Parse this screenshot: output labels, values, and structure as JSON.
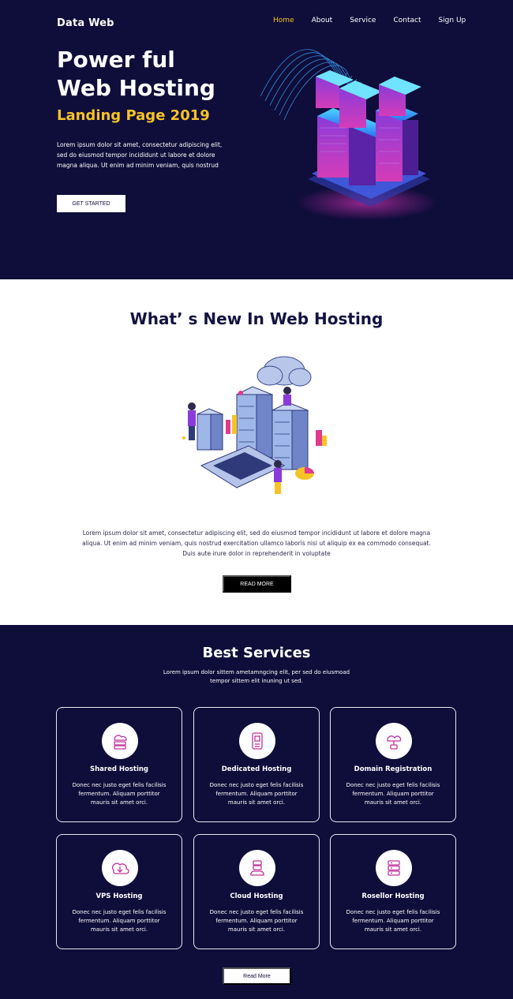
{
  "header": {
    "brand": "Data Web",
    "nav": [
      "Home",
      "About",
      "Service",
      "Contact",
      "Sign Up"
    ],
    "active_nav": "Home"
  },
  "hero": {
    "title_line1": "Power ful",
    "title_line2": "Web Hosting",
    "subtitle": "Landing Page 2019",
    "text": "Lorem ipsum dolor sit amet, consectetur adipiscing elit, sed do eiusmod tempor incididunt ut labore et dolore magna aliqua. Ut enim ad minim veniam, quis nostrud",
    "button": "GET STARTED"
  },
  "whats_new": {
    "title": "What’ s New In Web Hosting",
    "text": "Lorem ipsum dolor sit amet, consectetur adipiscing elit, sed do eiusmod tempor incididunt ut labore et dolore magna aliqua. Ut enim ad minim veniam, quis nostrud exercitation ullamco laboris nisi ut aliquip ex ea commodo consequat. Duis aute irure dolor in reprehenderit in voluptate",
    "button": "READ MORE"
  },
  "services": {
    "title": "Best Services",
    "description": "Lorem ipsum dolor sittem ametamngcing elit, per sed do eiusmoad tempor sittem elit inuning ut sed.",
    "cards": [
      {
        "title": "Shared Hosting",
        "text": "Donec nec justo eget felis facilisis fermentum. Aliquam porttitor mauris sit amet orci.",
        "icon": "server-cloud-icon"
      },
      {
        "title": "Dedicated Hosting",
        "text": "Donec nec justo eget felis facilisis fermentum. Aliquam porttitor mauris sit amet orci.",
        "icon": "dedicated-server-icon"
      },
      {
        "title": "Domain Registration",
        "text": "Donec nec justo eget felis facilisis fermentum. Aliquam porttitor mauris sit amet orci.",
        "icon": "domain-cloud-icon"
      },
      {
        "title": "VPS Hosting",
        "text": "Donec nec justo eget felis facilisis fermentum. Aliquam porttitor mauris sit amet orci.",
        "icon": "cloud-download-icon"
      },
      {
        "title": "Cloud Hosting",
        "text": "Donec nec justo eget felis facilisis fermentum. Aliquam porttitor mauris sit amet orci.",
        "icon": "cloud-server-icon"
      },
      {
        "title": "Rosellor Hosting",
        "text": "Donec nec justo eget felis facilisis fermentum. Aliquam porttitor mauris sit amet orci.",
        "icon": "reseller-server-icon"
      }
    ],
    "button": "Read More"
  },
  "colors": {
    "navy": "#0f0d3a",
    "accent_yellow": "#f7c326",
    "icon_magenta": "#c0339b"
  }
}
